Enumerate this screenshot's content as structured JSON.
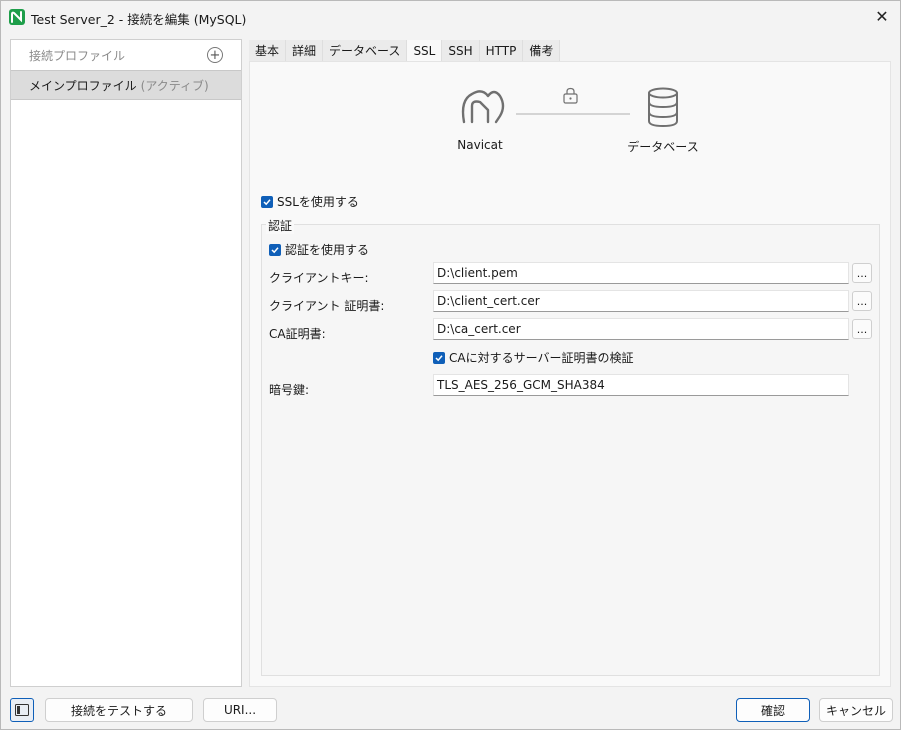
{
  "window": {
    "title": "Test Server_2 - 接続を編集 (MySQL)",
    "close_glyph": "✕",
    "app_icon": "navicat-app-icon"
  },
  "sidebar": {
    "header_label": "接続プロファイル",
    "add_glyph": "+",
    "profiles": [
      {
        "label": "メインプロファイル",
        "tag": "(アクティブ)"
      }
    ]
  },
  "tabs": [
    {
      "label": "基本",
      "active": false
    },
    {
      "label": "詳細",
      "active": false
    },
    {
      "label": "データベース",
      "active": false
    },
    {
      "label": "SSL",
      "active": true
    },
    {
      "label": "SSH",
      "active": false
    },
    {
      "label": "HTTP",
      "active": false
    },
    {
      "label": "備考",
      "active": false
    }
  ],
  "diagram": {
    "left_label": "Navicat",
    "right_label": "データベース",
    "left_icon": "navicat-logo-icon",
    "right_icon": "database-icon",
    "link_icon": "lock-icon"
  },
  "ssl": {
    "use_ssl_label": "SSLを使用する",
    "use_ssl_checked": true,
    "auth_group_title": "認証",
    "use_auth_label": "認証を使用する",
    "use_auth_checked": true,
    "client_key_label": "クライアントキー:",
    "client_key_value": "D:\\client.pem",
    "client_cert_label": "クライアント 証明書:",
    "client_cert_value": "D:\\client_cert.cer",
    "ca_cert_label": "CA証明書:",
    "ca_cert_value": "D:\\ca_cert.cer",
    "verify_ca_label": "CAに対するサーバー証明書の検証",
    "verify_ca_checked": true,
    "cipher_label": "暗号鍵:",
    "cipher_value": "TLS_AES_256_GCM_SHA384",
    "browse_label": "..."
  },
  "footer": {
    "test_connection_label": "接続をテストする",
    "uri_label": "URI...",
    "ok_label": "確認",
    "cancel_label": "キャンセル"
  },
  "colors": {
    "accent": "#0f5fb8",
    "brand": "#1e9e4a"
  }
}
